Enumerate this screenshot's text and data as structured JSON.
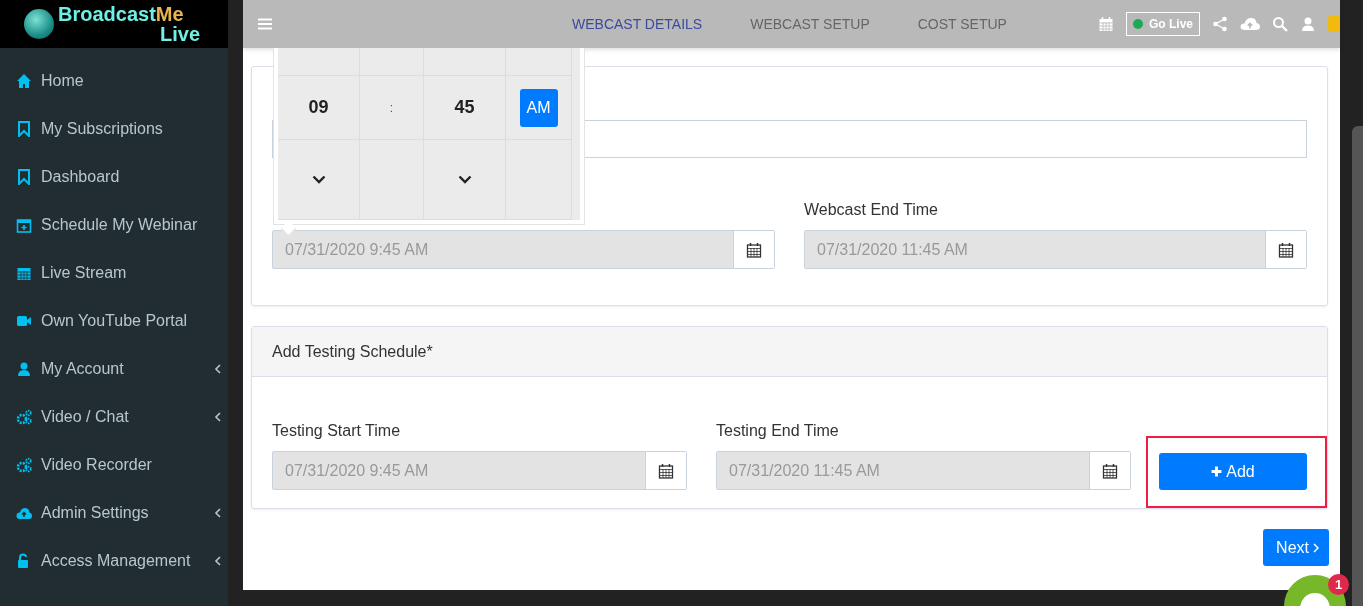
{
  "logo": {
    "word_1": "Broadcast",
    "word_2": "Me",
    "word_3": "Live"
  },
  "sidebar": {
    "items": [
      {
        "label": "Home",
        "has_submenu": false
      },
      {
        "label": "My Subscriptions",
        "has_submenu": false
      },
      {
        "label": "Dashboard",
        "has_submenu": false
      },
      {
        "label": "Schedule My Webinar",
        "has_submenu": false
      },
      {
        "label": "Live Stream",
        "has_submenu": false
      },
      {
        "label": "Own YouTube Portal",
        "has_submenu": false
      },
      {
        "label": "My Account",
        "has_submenu": true
      },
      {
        "label": "Video / Chat",
        "has_submenu": true
      },
      {
        "label": "Video Recorder",
        "has_submenu": false
      },
      {
        "label": "Admin Settings",
        "has_submenu": true
      },
      {
        "label": "Access Management",
        "has_submenu": true
      }
    ]
  },
  "tabs": [
    {
      "label": "WEBCAST DETAILS",
      "selected": true
    },
    {
      "label": "WEBCAST SETUP",
      "selected": false
    },
    {
      "label": "COST SETUP",
      "selected": false
    }
  ],
  "go_live": {
    "label": "Go Live"
  },
  "time_picker": {
    "hour": "09",
    "separator": ":",
    "minute": "45",
    "period": "AM"
  },
  "webcast_card": {
    "end_label": "Webcast End Time",
    "start_value": "07/31/2020 9:45 AM",
    "end_value": "07/31/2020 11:45 AM"
  },
  "testing_card": {
    "title": "Add Testing Schedule*",
    "start_label": "Testing Start Time",
    "start_value": "07/31/2020 9:45 AM",
    "end_label": "Testing End Time",
    "end_value": "07/31/2020 11:45 AM",
    "add_label": "Add",
    "add_highlighted": true
  },
  "next_button": {
    "label": "Next"
  },
  "chat": {
    "badge": "1"
  }
}
